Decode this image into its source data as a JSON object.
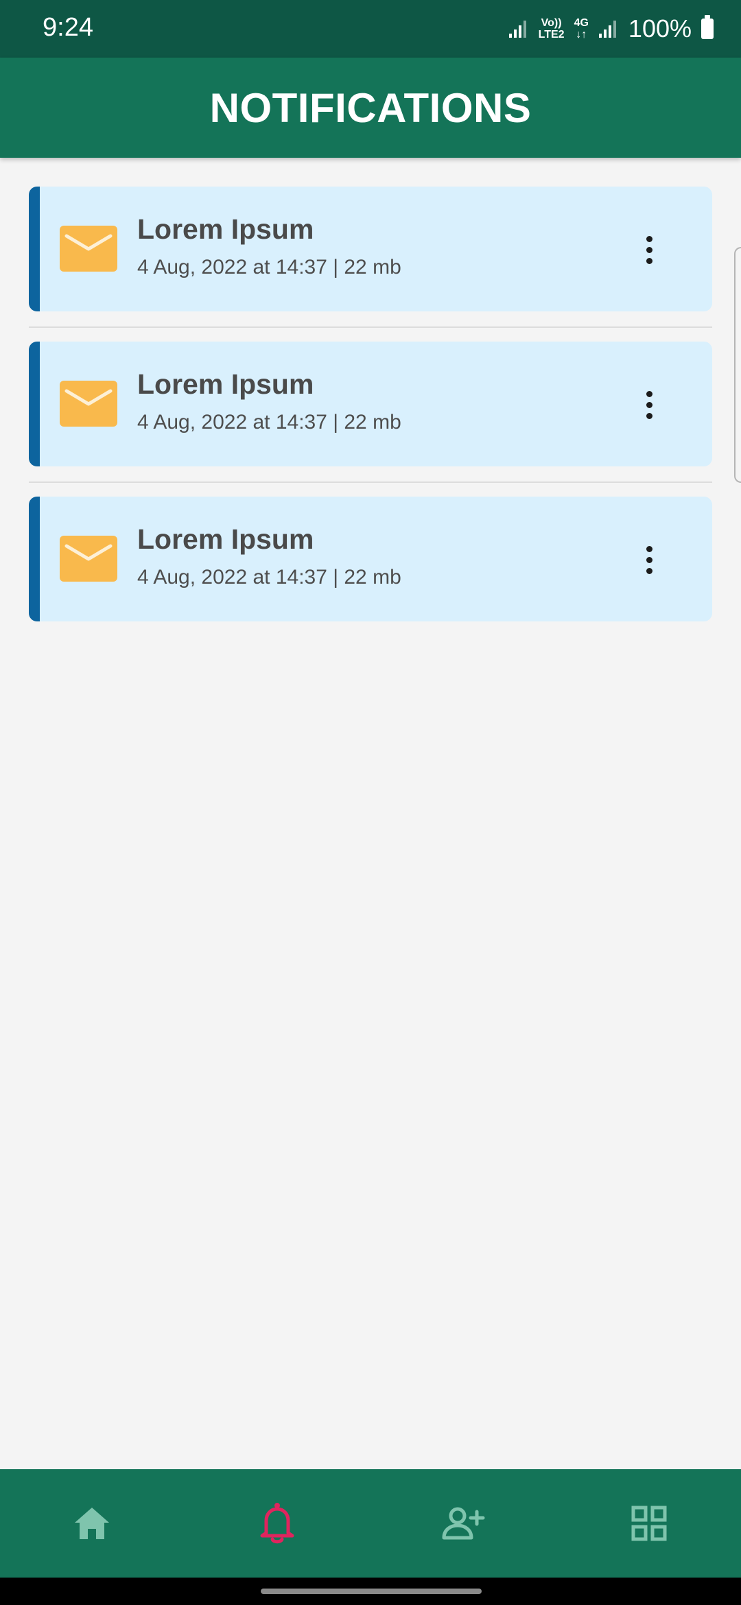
{
  "status_bar": {
    "time": "9:24",
    "network_top": "Vo))",
    "network_bottom": "LTE2",
    "network2_top": "4G",
    "network2_bottom": "↓↑",
    "battery": "100%"
  },
  "header": {
    "title": "NOTIFICATIONS"
  },
  "notifications": [
    {
      "title": "Lorem Ipsum",
      "meta": "4 Aug, 2022 at 14:37 | 22 mb",
      "icon": "mail-icon"
    },
    {
      "title": "Lorem Ipsum",
      "meta": "4 Aug, 2022 at 14:37 | 22 mb",
      "icon": "mail-icon"
    },
    {
      "title": "Lorem Ipsum",
      "meta": "4 Aug, 2022 at 14:37 | 22 mb",
      "icon": "mail-icon"
    }
  ],
  "bottom_nav": [
    {
      "icon": "home-icon",
      "active": false
    },
    {
      "icon": "bell-icon",
      "active": true
    },
    {
      "icon": "add-user-icon",
      "active": false
    },
    {
      "icon": "grid-icon",
      "active": false
    }
  ],
  "colors": {
    "status_bar": "#0e5745",
    "header": "#147458",
    "card_background": "#d9f0fd",
    "card_accent": "#0d649e",
    "mail_icon": "#f9b94c",
    "nav_inactive": "#7fc4ad",
    "nav_active": "#e0245e"
  }
}
